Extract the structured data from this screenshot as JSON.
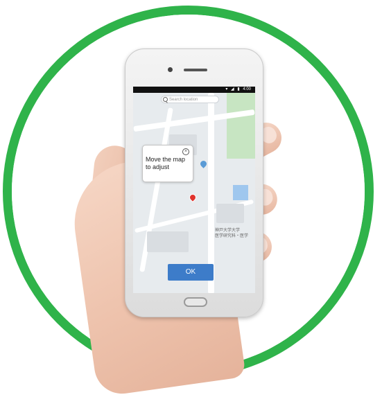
{
  "colors": {
    "ring": "#2fb34a",
    "ok_button": "#3d7cc9",
    "map_park": "#c7e5c2",
    "map_water": "#9fc7ee",
    "pin_red": "#e0332d",
    "pin_blue": "#5a9bd6"
  },
  "phone": {
    "status_bar": {
      "icons": [
        "wifi-icon",
        "signal-icon",
        "battery-icon"
      ],
      "time": "4:00"
    },
    "search": {
      "placeholder": "Search location"
    },
    "popup": {
      "message": "Move the map to adjust",
      "close_icon": "close-icon"
    },
    "map": {
      "label_line1": "神戸大学大学",
      "label_line2": "医学研究科・医学"
    },
    "ok_label": "OK"
  }
}
